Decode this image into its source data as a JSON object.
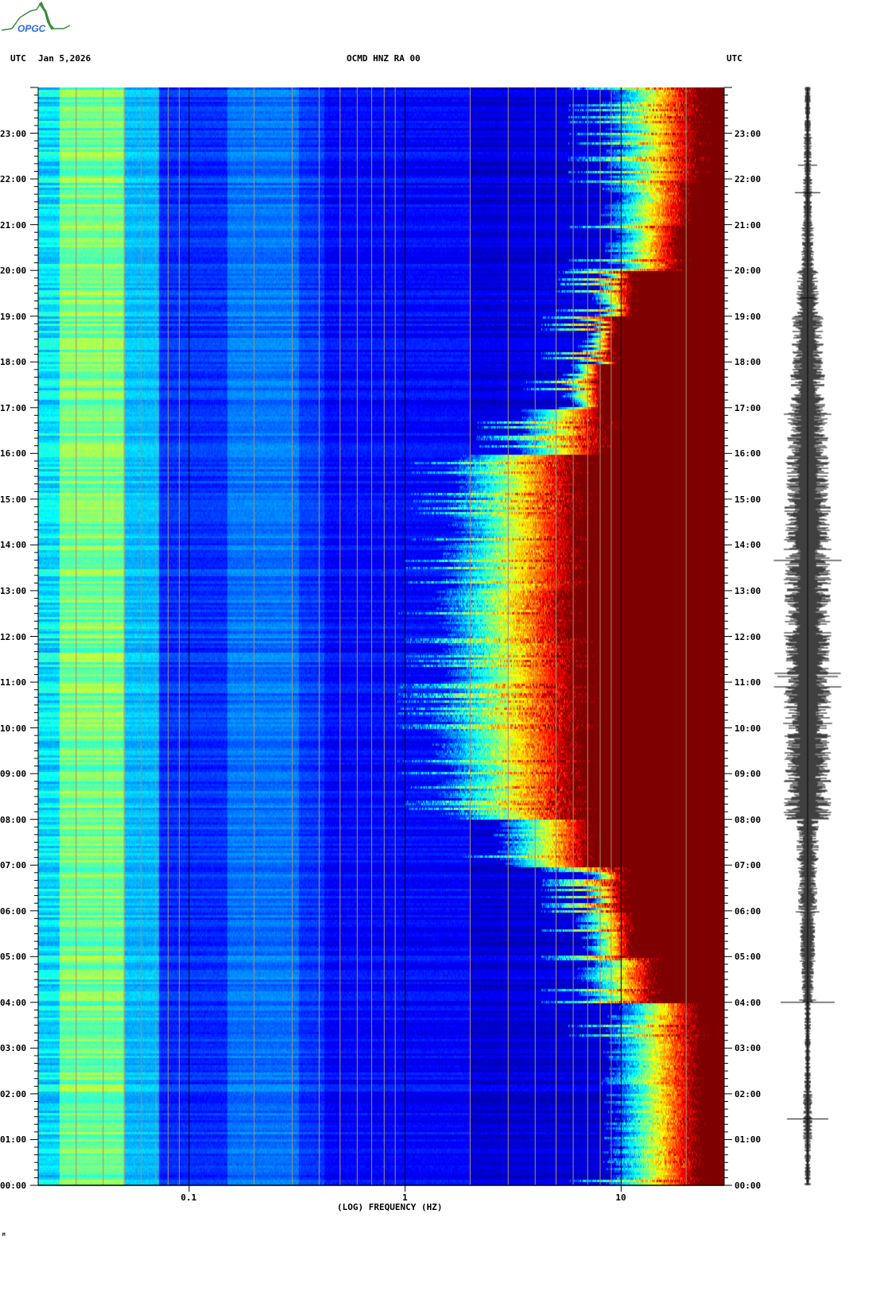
{
  "header": {
    "left_tz": "UTC",
    "date": "Jan 5,2026",
    "station": "OCMD HNZ RA 00",
    "right_tz": "UTC",
    "logo_text": "OPGC",
    "footer_mark": "M"
  },
  "chart_data": {
    "type": "heatmap",
    "title": "OCMD HNZ RA 00",
    "xlabel": "(LOG) FREQUENCY (HZ)",
    "ylabel": "UTC",
    "x_scale": "log",
    "xlim_hz": [
      0.02,
      30
    ],
    "ylim_hours": [
      0,
      24
    ],
    "x_ticks": [
      {
        "value": 0.1,
        "label": "0.1"
      },
      {
        "value": 1,
        "label": "1"
      },
      {
        "value": 10,
        "label": "10"
      }
    ],
    "y_ticks": [
      "00:00",
      "01:00",
      "02:00",
      "03:00",
      "04:00",
      "05:00",
      "06:00",
      "07:00",
      "08:00",
      "09:00",
      "10:00",
      "11:00",
      "12:00",
      "13:00",
      "14:00",
      "15:00",
      "16:00",
      "17:00",
      "18:00",
      "19:00",
      "20:00",
      "21:00",
      "22:00",
      "23:00"
    ],
    "colormap": [
      "#00007f",
      "#0000ff",
      "#00ffff",
      "#ffff00",
      "#ff0000",
      "#7f0000"
    ],
    "gridline_color": "#a89070",
    "hourly_activity": {
      "hours": [
        0,
        1,
        2,
        3,
        4,
        5,
        6,
        7,
        8,
        9,
        10,
        11,
        12,
        13,
        14,
        15,
        16,
        17,
        18,
        19,
        20,
        21,
        22,
        23
      ],
      "onset_hz": [
        8,
        8,
        8,
        8,
        6,
        6,
        6,
        2.5,
        1.4,
        1.3,
        1.3,
        1.4,
        1.3,
        1.4,
        1.5,
        1.5,
        3,
        5,
        6,
        7,
        8,
        8,
        8,
        8
      ],
      "saturation_hz": [
        22,
        22,
        22,
        22,
        14,
        11,
        10,
        7,
        6,
        6,
        6,
        6,
        5.5,
        6,
        6,
        6,
        8,
        8,
        9,
        11,
        18,
        20,
        22,
        22
      ]
    },
    "seismogram_amplitude": [
      4,
      6,
      4,
      4,
      8,
      10,
      12,
      14,
      30,
      30,
      32,
      28,
      30,
      30,
      30,
      28,
      26,
      22,
      20,
      14,
      8,
      6,
      5,
      4
    ]
  }
}
